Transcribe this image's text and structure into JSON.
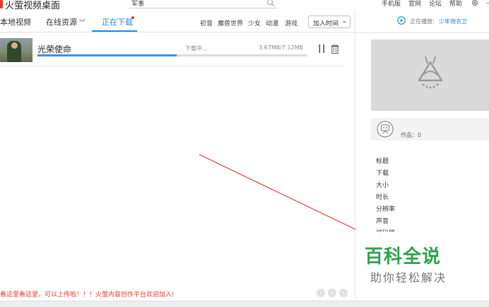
{
  "app": {
    "title": "火萤视频桌面"
  },
  "search": {
    "value": "军事"
  },
  "top_links": [
    "手机版",
    "官网",
    "论坛",
    "帮助"
  ],
  "tabs": [
    {
      "label": "本地视频"
    },
    {
      "label": "在线资源"
    },
    {
      "label": "正在下载"
    }
  ],
  "filters": [
    "初音",
    "魔兽世界",
    "少女",
    "动漫",
    "游戏"
  ],
  "sort": {
    "selected": "加入时间"
  },
  "download": {
    "title": "光荣使命",
    "status": "下载中...",
    "size": "3.67MB/7.12MB",
    "progress": 0.516
  },
  "right_panel": {
    "now_playing_label": "正在播放:",
    "now_playing_value": "少年锦衣卫",
    "works_label": "作品：0",
    "meta": [
      "标题",
      "下载",
      "大小",
      "时长",
      "分辨率",
      "声音",
      "编码器"
    ]
  },
  "watermark": {
    "main": "百科全说",
    "sub": "助你轻松解决"
  },
  "notice": "看这里看这里，可以上传啦！！！火萤内容创作平台欢迎加入!",
  "colors": {
    "accent": "#1e88e5",
    "brand": "#e8392a",
    "annotation": "#e53935",
    "watermark": "#2ea24a"
  }
}
